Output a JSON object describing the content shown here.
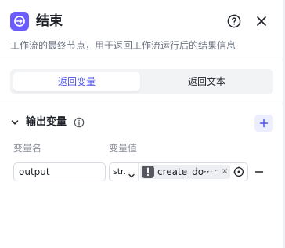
{
  "header": {
    "title": "结束",
    "description": "工作流的最终节点，用于返回工作流运行后的结果信息",
    "node_icon": "end-node-icon",
    "help_icon": "question-circle-icon",
    "close_icon": "close-icon"
  },
  "tabs": [
    {
      "label": "返回变量",
      "active": true
    },
    {
      "label": "返回文本",
      "active": false
    }
  ],
  "output_section": {
    "title": "输出变量",
    "columns": {
      "name": "变量名",
      "value": "变量值"
    },
    "rows": [
      {
        "name": "output",
        "type": "str.",
        "reference": "create_do···",
        "reference_dot": "·",
        "clear_glyph": "×"
      }
    ]
  },
  "colors": {
    "accent": "#4d53e8",
    "node_icon_bg": "#6a5cff",
    "tab_bg": "#f2f3f5",
    "add_btn_bg": "#eceefe"
  }
}
